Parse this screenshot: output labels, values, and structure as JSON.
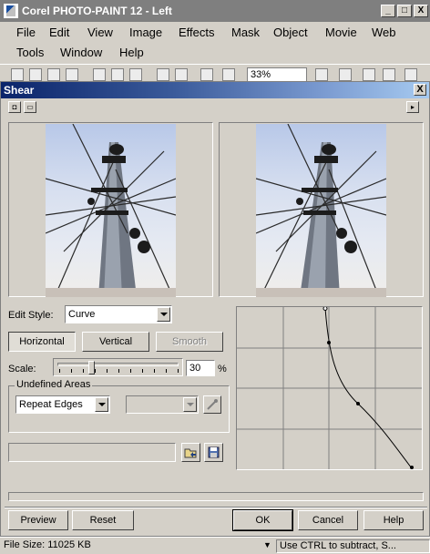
{
  "app": {
    "title": "Corel PHOTO-PAINT 12 - Left",
    "minimize": "_",
    "maximize": "□",
    "close": "X"
  },
  "menu": [
    {
      "label": "File"
    },
    {
      "label": "Edit"
    },
    {
      "label": "View"
    },
    {
      "label": "Image"
    },
    {
      "label": "Effects"
    },
    {
      "label": "Mask"
    },
    {
      "label": "Object"
    },
    {
      "label": "Movie"
    },
    {
      "label": "Web"
    },
    {
      "label": "Tools"
    },
    {
      "label": "Window"
    },
    {
      "label": "Help"
    }
  ],
  "toolbar": {
    "zoom": "33%"
  },
  "dialog": {
    "title": "Shear",
    "close": "X",
    "edit_style_label": "Edit Style:",
    "edit_style_value": "Curve",
    "horizontal_label": "Horizontal",
    "vertical_label": "Vertical",
    "smooth_label": "Smooth",
    "scale_label": "Scale:",
    "scale_value": "30",
    "scale_unit": "%",
    "undefined_areas_label": "Undefined Areas",
    "undefined_areas_value": "Repeat Edges",
    "preview_label": "Preview",
    "reset_label": "Reset",
    "ok_label": "OK",
    "cancel_label": "Cancel",
    "help_label": "Help"
  },
  "status": {
    "file_size": "File Size: 11025 KB",
    "hint": "Use CTRL to subtract, S..."
  },
  "colors": {
    "dialog_title_start": "#0a246a",
    "dialog_title_end": "#a6caf0",
    "face": "#d4d0c8"
  }
}
